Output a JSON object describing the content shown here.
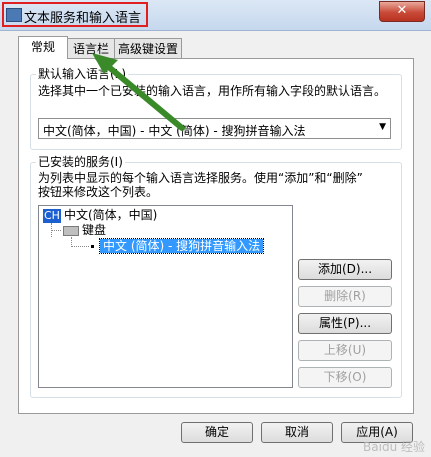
{
  "window": {
    "title": "文本服务和输入语言",
    "close_glyph": "✕"
  },
  "tabs": [
    {
      "label": "常规"
    },
    {
      "label": "语言栏"
    },
    {
      "label": "高级键设置"
    }
  ],
  "default_language": {
    "label": "默认输入语言(L)",
    "description": "选择其中一个已安装的输入语言，用作所有输入字段的默认语言。",
    "selected_value": "中文(简体，中国) - 中文 (简体) - 搜狗拼音输入法"
  },
  "installed_services": {
    "label": "已安装的服务(I)",
    "description_line1": "为列表中显示的每个输入语言选择服务。使用“添加”和“删除”",
    "description_line2": "按钮来修改这个列表。",
    "tree": {
      "language_code": "CH",
      "language": "中文(简体，中国)",
      "category": "键盘",
      "service": "中文 (简体) - 搜狗拼音输入法"
    },
    "buttons": {
      "add": "添加(D)...",
      "remove": "删除(R)",
      "properties": "属性(P)...",
      "move_up": "上移(U)",
      "move_down": "下移(O)"
    }
  },
  "footer": {
    "ok": "确定",
    "cancel": "取消",
    "apply": "应用(A)"
  },
  "colors": {
    "highlight_box": "#e02020",
    "annotation_arrow": "#3a8a2a",
    "selection": "#3399ff"
  }
}
